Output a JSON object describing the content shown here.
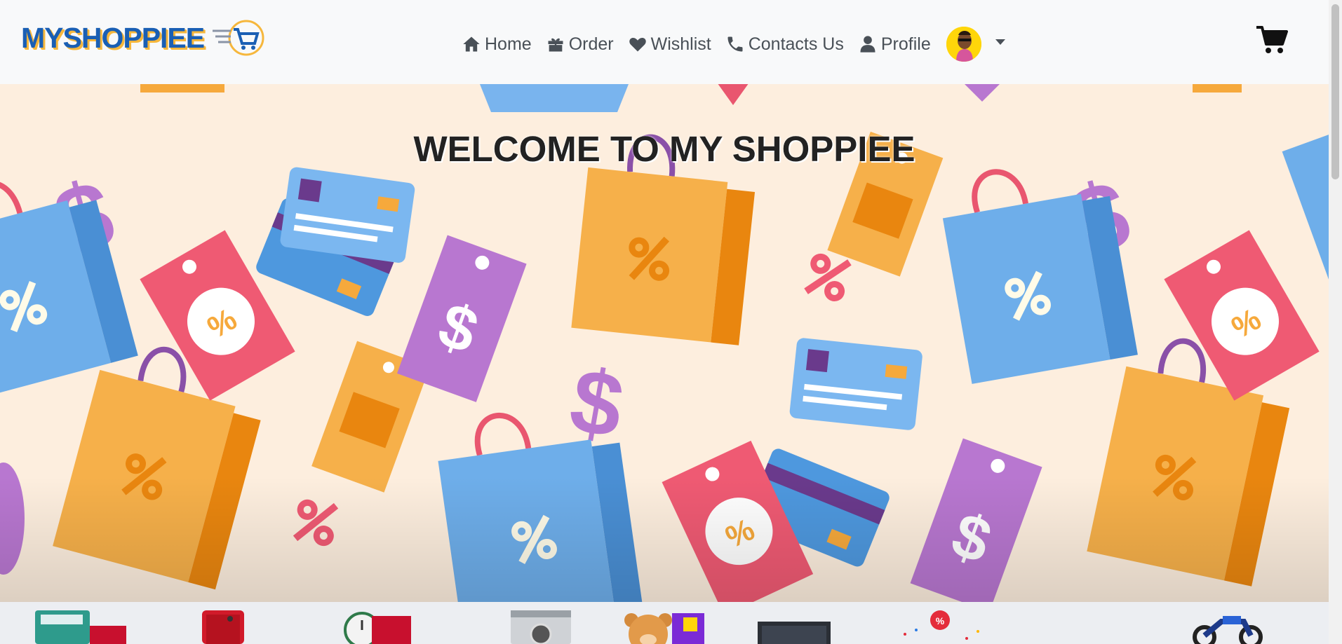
{
  "brand": {
    "name": "MYSHOPPIEE"
  },
  "nav": {
    "items": [
      {
        "label": "Home",
        "icon": "home-icon"
      },
      {
        "label": "Order",
        "icon": "gift-icon"
      },
      {
        "label": "Wishlist",
        "icon": "heart-icon"
      },
      {
        "label": "Contacts Us",
        "icon": "phone-icon"
      },
      {
        "label": "Profile",
        "icon": "user-icon"
      }
    ]
  },
  "hero": {
    "title": "WELCOME TO MY SHOPPIEE"
  },
  "colors": {
    "brand_blue": "#1a5fb4",
    "brand_orange": "#f6b73c",
    "nav_text": "#495057",
    "hero_bg": "#fdeede"
  },
  "products": [
    "pantyliners",
    "red-smartphone",
    "alarm-clock",
    "washing-machine",
    "teddy-bear",
    "laptop",
    "sale-balloon",
    "motorcycle"
  ]
}
